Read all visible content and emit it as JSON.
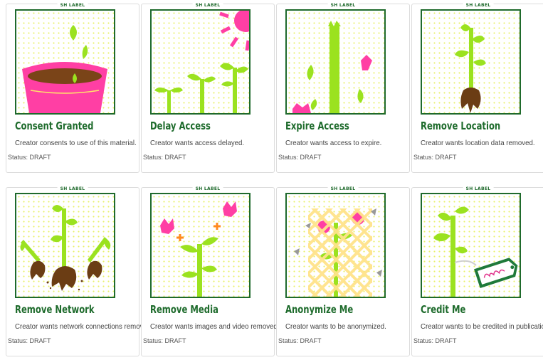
{
  "colors": {
    "accent_green": "#1f6a2c",
    "lime": "#9be21f",
    "pink": "#ff3fa4",
    "soil": "#6b3d14"
  },
  "cards": [
    {
      "tag": "SH LABEL",
      "title": "Consent Granted",
      "description": "Creator consents to use of this material.",
      "status": "Status: DRAFT",
      "icon": "flower-pot-seedling"
    },
    {
      "tag": "SH LABEL",
      "title": "Delay Access",
      "description": "Creator wants access delayed.",
      "status": "Status: DRAFT",
      "icon": "growing-sprouts-sun"
    },
    {
      "tag": "SH LABEL",
      "title": "Expire Access",
      "description": "Creator wants access to expire.",
      "status": "Status: DRAFT",
      "icon": "cut-stem-falling-leaves"
    },
    {
      "tag": "SH LABEL",
      "title": "Remove Location",
      "description": "Creator wants location data removed.",
      "status": "Status: DRAFT",
      "icon": "uprooted-plant"
    },
    {
      "tag": "SH LABEL",
      "title": "Remove Network",
      "description": "Creator wants network connections removed.",
      "status": "Status: DRAFT",
      "icon": "uprooted-plants-network"
    },
    {
      "tag": "SH LABEL",
      "title": "Remove Media",
      "description": "Creator wants images and video removed.",
      "status": "Status: DRAFT",
      "icon": "plant-removed-flowers"
    },
    {
      "tag": "SH LABEL",
      "title": "Anonymize Me",
      "description": "Creator wants to be anonymized.",
      "status": "Status: DRAFT",
      "icon": "plant-behind-lattice"
    },
    {
      "tag": "SH LABEL",
      "title": "Credit Me",
      "description": "Creator wants to be credited in publications.",
      "status": "Status: DRAFT",
      "icon": "plant-with-name-tag"
    }
  ]
}
